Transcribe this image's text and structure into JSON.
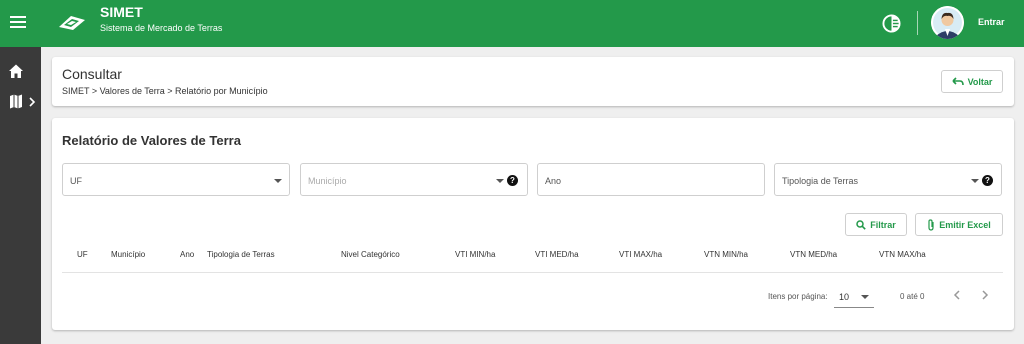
{
  "header": {
    "title": "SIMET",
    "subtitle": "Sistema de Mercado de Terras",
    "login_label": "Entrar",
    "color": "#23994a"
  },
  "sidebar": {
    "items": [
      {
        "icon": "home-icon"
      },
      {
        "icon": "map-icon"
      }
    ]
  },
  "page": {
    "title": "Consultar",
    "breadcrumb": "SIMET > Valores de Terra > Relatório por Município",
    "back_label": "Voltar"
  },
  "report": {
    "title": "Relatório de Valores de Terra",
    "fields": {
      "uf": "UF",
      "municipio": "Município",
      "ano": "Ano",
      "tipologia": "Tipologia de Terras"
    },
    "help_glyph": "?",
    "filter_label": "Filtrar",
    "excel_label": "Emitir Excel",
    "columns": [
      "UF",
      "Município",
      "Ano",
      "Tipologia de Terras",
      "Nivel Categórico",
      "VTI MIN/ha",
      "VTI MED/ha",
      "VTI MAX/ha",
      "VTN MIN/ha",
      "VTN MED/ha",
      "VTN MAX/ha"
    ]
  },
  "pagination": {
    "items_per_page_label": "Itens por página:",
    "page_size": "10",
    "range": "0 até 0"
  }
}
